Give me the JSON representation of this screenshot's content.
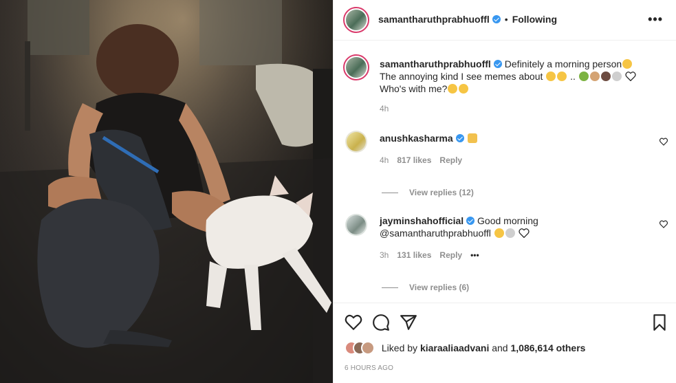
{
  "post": {
    "username": "samantharuthprabhuoffl",
    "follow_status": "Following",
    "header_dot": "•",
    "more_label": "•••"
  },
  "caption": {
    "username": "samantharuthprabhuoffl",
    "line1": "Definitely a morning person",
    "line2": "The annoying kind I see memes about",
    "line2_sep": "..",
    "line3": "Who's with me?",
    "time": "4h"
  },
  "comments": [
    {
      "username": "anushkasharma",
      "text": "",
      "time": "4h",
      "likes": "817 likes",
      "reply": "Reply",
      "view_replies": "View replies (12)"
    },
    {
      "username": "jayminshahofficial",
      "text": "Good morning",
      "mention": "@samantharuthprabhuoffl",
      "time": "3h",
      "likes": "131 likes",
      "reply": "Reply",
      "more": "•••",
      "view_replies": "View replies (6)"
    }
  ],
  "likes": {
    "prefix": "Liked by",
    "user": "kiaraaliaadvani",
    "and": "and",
    "others": "1,086,614 others"
  },
  "posted_ago": "6 HOURS AGO",
  "icons": {
    "heart": "heart-icon",
    "comment": "comment-icon",
    "share": "share-icon",
    "save": "bookmark-icon"
  },
  "colors": {
    "verified": "#3897f0",
    "story_ring": "#d93a6b",
    "muted": "#8e8e8e",
    "text": "#262626"
  }
}
